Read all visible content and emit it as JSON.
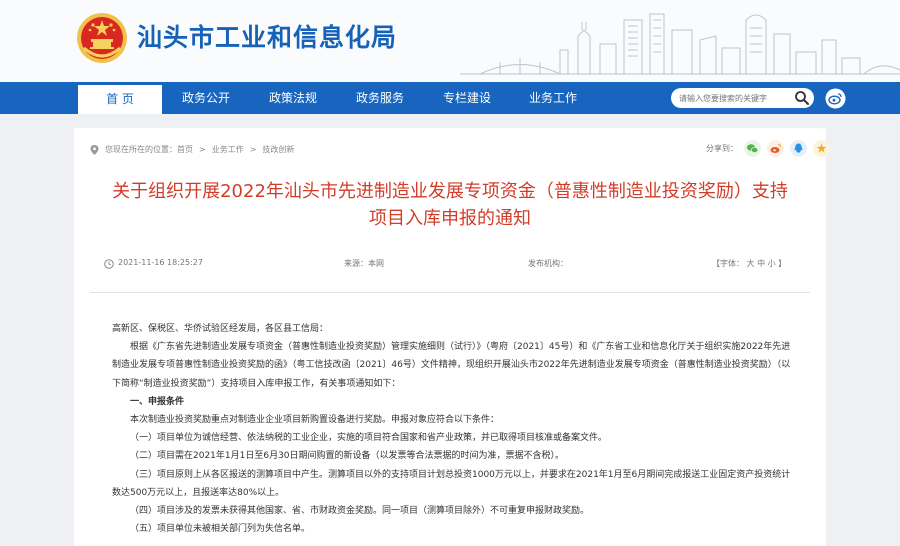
{
  "site": {
    "title": "汕头市工业和信息化局"
  },
  "nav": {
    "items": [
      {
        "label": "首 页",
        "active": true
      },
      {
        "label": "政务公开",
        "active": false
      },
      {
        "label": "政策法规",
        "active": false
      },
      {
        "label": "政务服务",
        "active": false
      },
      {
        "label": "专栏建设",
        "active": false
      },
      {
        "label": "业务工作",
        "active": false
      }
    ],
    "search_placeholder": "请输入您要搜索的关键字"
  },
  "breadcrumb": {
    "prefix": "您现在所在的位置：",
    "items": [
      "首页",
      "业务工作",
      "技改创新"
    ],
    "separator": ">"
  },
  "share": {
    "label": "分享到："
  },
  "article": {
    "title_line1": "关于组织开展2022年汕头市先进制造业发展专项资金（普惠性制造业投资奖励）支持",
    "title_line2": "项目入库申报的通知",
    "date": "2021-11-16 18:25:27",
    "source": "来源：本网",
    "publisher": "发布机构：",
    "font_size": "【字体： 大 中 小 】",
    "paragraphs": [
      "高新区、保税区、华侨试验区经发局，各区县工信局：",
      "根据《广东省先进制造业发展专项资金（普惠性制造业投资奖励）管理实施细则（试行）》（粤府〔2021〕45号）和《广东省工业和信息化厅关于组织实施2022年先进制造业发展专项普惠性制造业投资奖励的函》（粤工信技改函〔2021〕46号）文件精神，现组织开展汕头市2022年先进制造业发展专项资金（普惠性制造业投资奖励）（以下简称“制造业投资奖励”）支持项目入库申报工作，有关事项通知如下：",
      "一、申报条件",
      "本次制造业投资奖励重点对制造业企业项目新购置设备进行奖励。申报对象应符合以下条件：",
      "（一）项目单位为诚信经营、依法纳税的工业企业，实施的项目符合国家和省产业政策，并已取得项目核准或备案文件。",
      "（二）项目需在2021年1月1日至6月30日期间购置的新设备（以发票等合法票据的时间为准，票据不含税）。",
      "（三）项目原则上从各区报送的测算项目中产生。测算项目以外的支持项目计划总投资1000万元以上，并要求在2021年1月至6月期间完成报送工业固定资产投资统计数达500万元以上，且报送率达80%以上。",
      "（四）项目涉及的发票未获得其他国家、省、市财政资金奖励。同一项目（测算项目除外）不可重复申报财政奖励。",
      "（五）项目单位未被相关部门列为失信名单。"
    ]
  },
  "colors": {
    "brand_blue": "#1765bf",
    "title_red": "#d23d2a"
  }
}
